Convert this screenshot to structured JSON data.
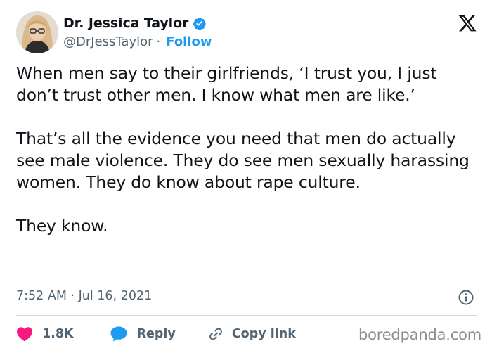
{
  "author": {
    "name": "Dr. Jessica Taylor",
    "handle": "@DrJessTaylor",
    "separator": "·",
    "follow_label": "Follow"
  },
  "tweet": {
    "paragraphs": [
      "When men say to their girlfriends, ‘I trust you, I just don’t trust other men. I know what men are like.’",
      "That’s all the evidence you need that men do actually see male violence. They do see men sexually harassing women. They do know about rape culture.",
      "They know."
    ],
    "timestamp": "7:52 AM · Jul 16, 2021"
  },
  "actions": {
    "like_count": "1.8K",
    "reply_label": "Reply",
    "copy_label": "Copy link"
  },
  "watermark": "boredpanda.com",
  "colors": {
    "like": "#f91880",
    "reply": "#1d9bf0",
    "link": "#1d9bf0",
    "text": "#0f1419",
    "muted": "#536471"
  },
  "icons": [
    "verified-badge-icon",
    "x-logo-icon",
    "info-icon",
    "heart-icon",
    "reply-bubble-icon",
    "link-icon"
  ]
}
